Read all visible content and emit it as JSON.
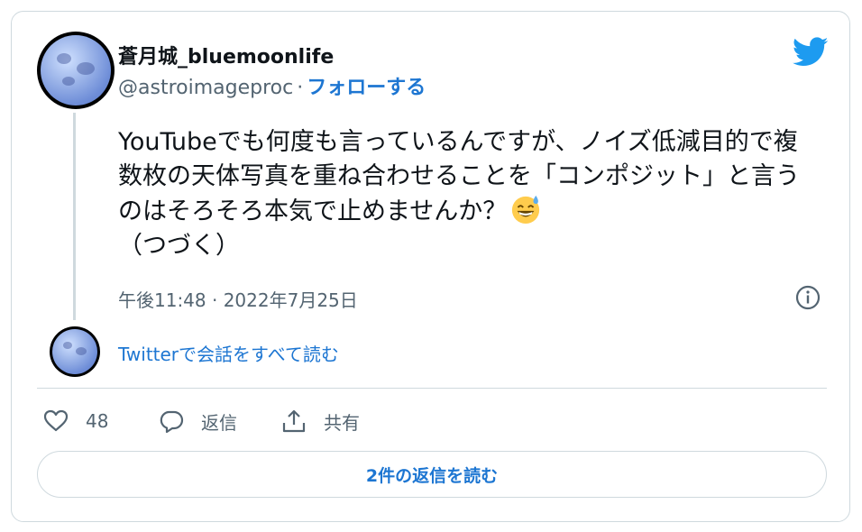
{
  "author": {
    "display_name": "蒼月城_bluemoonlife",
    "handle": "@astroimageproc",
    "separator": "·",
    "follow_label": "フォローする"
  },
  "tweet": {
    "text": "YouTubeでも何度も言っているんですが、ノイズ低減目的で複数枚の天体写真を重ね合わせることを「コンポジット」と言うのはそろそろ本気で止めませんか？",
    "text_tail": "（つづく）",
    "emoji": "grinning-face-with-sweat",
    "timestamp": "午後11:48 · 2022年7月25日"
  },
  "thread": {
    "read_conversation_label": "Twitterで会話をすべて読む"
  },
  "actions": {
    "like_count": "48",
    "reply_label": "返信",
    "share_label": "共有"
  },
  "footer": {
    "replies_button_label": "2件の返信を読む"
  },
  "colors": {
    "link_blue": "#1d76d2",
    "twitter_blue": "#1d9bf0",
    "secondary_text": "#536471",
    "border": "#cfd9de"
  },
  "icons": {
    "logo": "twitter-bird-icon",
    "info": "info-icon",
    "like": "heart-icon",
    "reply": "speech-bubble-icon",
    "share": "share-icon"
  }
}
